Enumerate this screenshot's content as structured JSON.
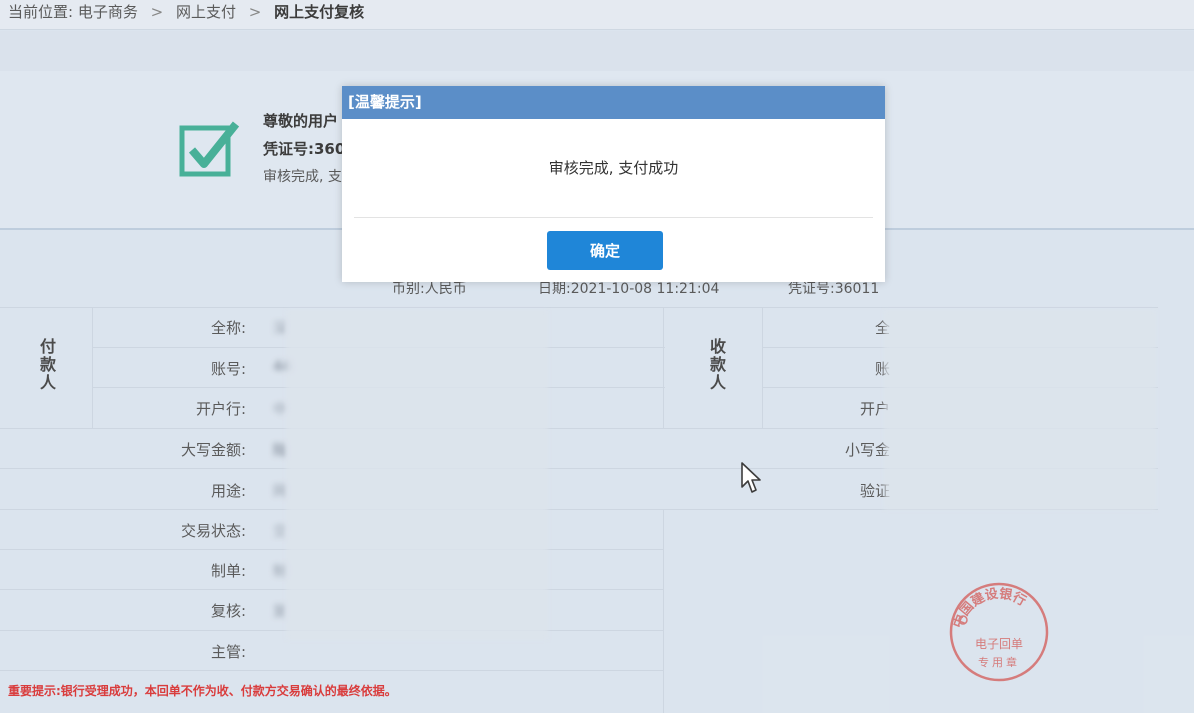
{
  "breadcrumb": {
    "prefix": "当前位置:",
    "items": [
      "电子商务",
      "网上支付"
    ],
    "separator": ">",
    "current": "网上支付复核"
  },
  "result": {
    "title": "尊敬的用户",
    "voucher": "凭证号:360",
    "status": "审核完成, 支"
  },
  "meta": {
    "currency": "币别:人民币",
    "date": "日期:2021-10-08  11:21:04",
    "voucher": "凭证号:36011"
  },
  "payer": {
    "section_label": "付款人",
    "name_label": "全称:",
    "account_label": "账号:",
    "bank_label": "开户行:",
    "name_value": "深",
    "account_value": "44",
    "bank_value": "中"
  },
  "payee": {
    "section_label": "收款人",
    "name_label": "全",
    "account_label": "账",
    "bank_label": "开户"
  },
  "fields": {
    "amount_upper_label": "大写金额:",
    "amount_upper_value": "陆",
    "amount_lower_label": "小写金",
    "purpose_label": "用途:",
    "purpose_value": "网",
    "verify_label": "验证",
    "tx_status_label": "交易状态:",
    "tx_status_value": "交",
    "maker_label": "制单:",
    "maker_value": "制",
    "reviewer_label": "复核:",
    "reviewer_value": "复",
    "supervisor_label": "主管:"
  },
  "important_note": "重要提示:银行受理成功，本回单不作为收、付款方交易确认的最终依据。",
  "stamp": {
    "ring_text": "中国建设银行",
    "line1": "电子回单",
    "line2": "专用章"
  },
  "dialog": {
    "title": "[温馨提示]",
    "message": "审核完成, 支付成功",
    "confirm_label": "确定"
  },
  "colors": {
    "accent": "#1f86d8",
    "dialog_header": "#5b8ec8",
    "check": "#2fa58a",
    "warning": "#d42222",
    "stamp": "#d06a6a"
  }
}
